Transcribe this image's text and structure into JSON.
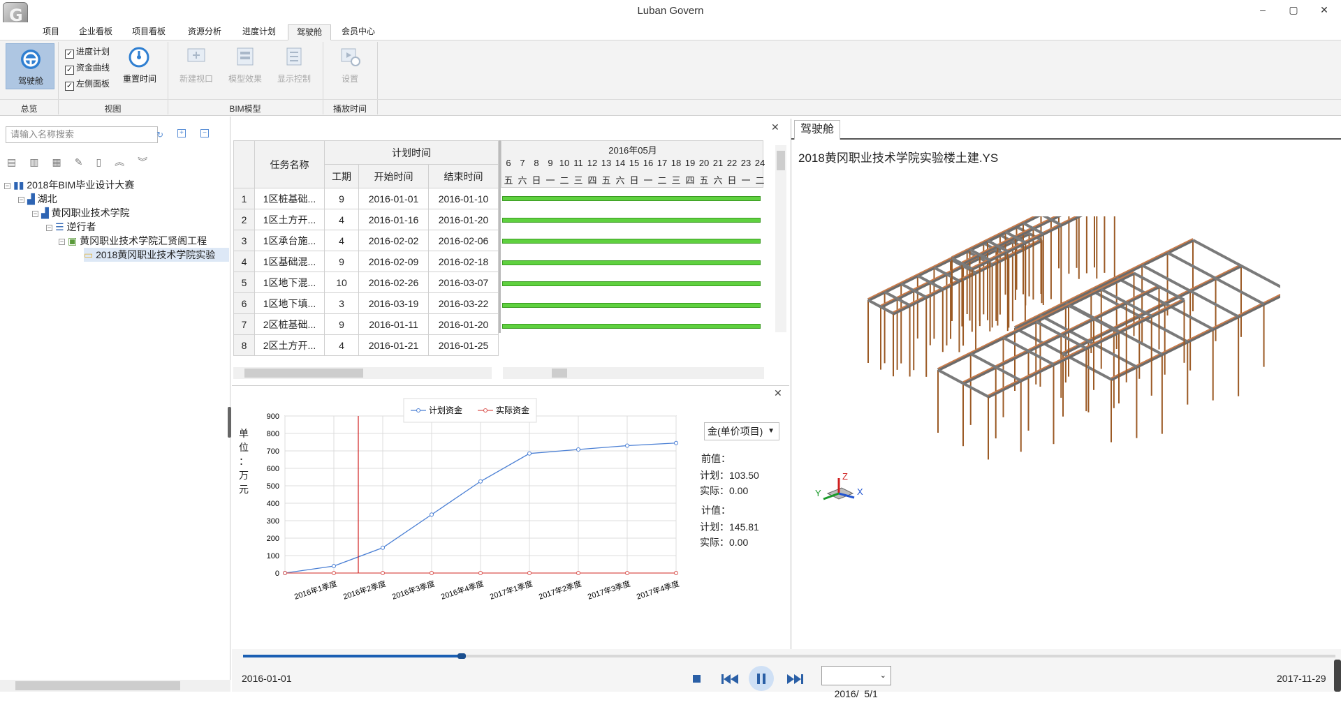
{
  "app": {
    "title": "Luban Govern"
  },
  "window": {
    "min": "–",
    "max": "▢",
    "close": "✕"
  },
  "menu": {
    "tabs": [
      "项目",
      "企业看板",
      "项目看板",
      "资源分析",
      "进度计划",
      "驾驶舱",
      "会员中心"
    ],
    "active": "驾驶舱"
  },
  "ribbon": {
    "cockpit": "驾驶舱",
    "checkboxes": [
      "进度计划",
      "资金曲线",
      "左侧面板"
    ],
    "reset_time": "重置时间",
    "new_view": "新建视口",
    "model_effect": "模型效果",
    "display_control": "显示控制",
    "settings": "设置",
    "groups": [
      "总览",
      "视图",
      "BIM模型",
      "播放时间"
    ]
  },
  "left": {
    "search_placeholder": "请输入名称搜索",
    "tree": [
      "2018年BIM毕业设计大赛",
      "湖北",
      "黄冈职业技术学院",
      "逆行者",
      "黄冈职业技术学院汇贤阁工程",
      "2018黄冈职业技术学院实验"
    ]
  },
  "gantt": {
    "headers": {
      "task": "任务名称",
      "plan": "计划时间",
      "duration": "工期",
      "start": "开始时间",
      "end": "结束时间",
      "month": "2016年05月"
    },
    "days": [
      "6",
      "7",
      "8",
      "9",
      "10",
      "11",
      "12",
      "13",
      "14",
      "15",
      "16",
      "17",
      "18",
      "19",
      "20",
      "21",
      "22",
      "23",
      "24"
    ],
    "weekdays": [
      "五",
      "六",
      "日",
      "一",
      "二",
      "三",
      "四",
      "五",
      "六",
      "日",
      "一",
      "二",
      "三",
      "四",
      "五",
      "六",
      "日",
      "一",
      "二"
    ],
    "rows": [
      {
        "no": "1",
        "name": "1区桩基础...",
        "dur": "9",
        "start": "2016-01-01",
        "end": "2016-01-10"
      },
      {
        "no": "2",
        "name": "1区土方开...",
        "dur": "4",
        "start": "2016-01-16",
        "end": "2016-01-20"
      },
      {
        "no": "3",
        "name": "1区承台施...",
        "dur": "4",
        "start": "2016-02-02",
        "end": "2016-02-06"
      },
      {
        "no": "4",
        "name": "1区基础混...",
        "dur": "9",
        "start": "2016-02-09",
        "end": "2016-02-18"
      },
      {
        "no": "5",
        "name": "1区地下混...",
        "dur": "10",
        "start": "2016-02-26",
        "end": "2016-03-07"
      },
      {
        "no": "6",
        "name": "1区地下填...",
        "dur": "3",
        "start": "2016-03-19",
        "end": "2016-03-22"
      },
      {
        "no": "7",
        "name": "2区桩基础...",
        "dur": "9",
        "start": "2016-01-11",
        "end": "2016-01-20"
      },
      {
        "no": "8",
        "name": "2区土方开...",
        "dur": "4",
        "start": "2016-01-21",
        "end": "2016-01-25"
      }
    ]
  },
  "chart_panel": {
    "unit_label": "单\n位\n：\n万\n元",
    "dropdown": "金(单价项目)",
    "current_label": "前值：",
    "plan_current": "计划：103.50",
    "actual_current": "实际：0.00",
    "total_label": "计值：",
    "plan_total": "计划：145.81",
    "actual_total": "实际：0.00"
  },
  "chart_data": {
    "type": "line",
    "categories": [
      "2016年1季度",
      "2016年2季度",
      "2016年3季度",
      "2016年4季度",
      "2017年1季度",
      "2017年2季度",
      "2017年3季度",
      "2017年4季度"
    ],
    "series": [
      {
        "name": "计划资金",
        "color": "#4a7fd4",
        "values": [
          0,
          40,
          145,
          335,
          525,
          685,
          708,
          730,
          745
        ]
      },
      {
        "name": "实际资金",
        "color": "#d9534f",
        "values": [
          0,
          0,
          0,
          0,
          0,
          0,
          0,
          0,
          0
        ]
      }
    ],
    "ylim": [
      0,
      900
    ],
    "yticks": [
      0,
      100,
      200,
      300,
      400,
      500,
      600,
      700,
      800,
      900
    ],
    "marker_value": 1.5,
    "grid": true,
    "legend": "top"
  },
  "viewport": {
    "tab": "驾驶舱",
    "model_name": "2018黄冈职业技术学院实验楼土建.YS",
    "axes": {
      "x": "X",
      "y": "Y",
      "z": "Z"
    }
  },
  "playback": {
    "start_date": "2016-01-01",
    "end_date": "2017-11-29",
    "current_date": "2016/  5/1",
    "progress": 0.2
  }
}
